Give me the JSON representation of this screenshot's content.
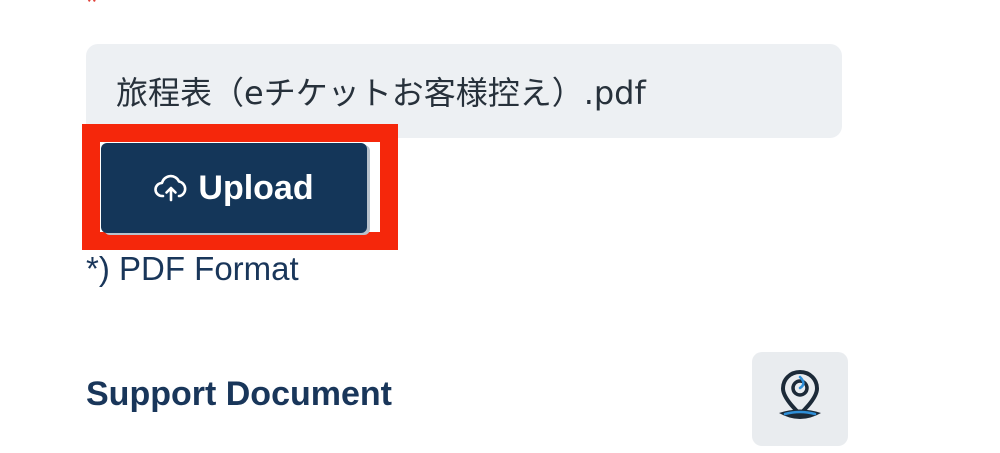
{
  "form": {
    "required_marker": "*",
    "file_name": "旅程表（eチケットお客様控え）.pdf",
    "upload_label": "Upload",
    "format_note": "*) PDF Format",
    "section_title": "Support Document"
  },
  "icons": {
    "upload": "cloud-upload-icon",
    "map": "map-pin-icon"
  },
  "colors": {
    "primary": "#143659",
    "highlight": "#f5270b",
    "field_bg": "#edf0f3",
    "required": "#e0433b"
  }
}
